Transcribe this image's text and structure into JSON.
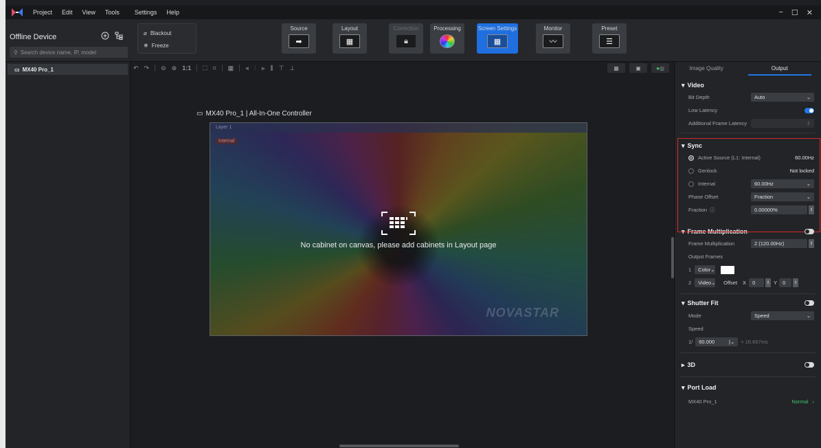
{
  "menu": [
    "Project",
    "Edit",
    "View",
    "Tools",
    "Settings",
    "Help"
  ],
  "window_controls": [
    "−",
    "☐",
    "✕"
  ],
  "device_panel": {
    "title": "Offline Device",
    "search_placeholder": "Search device name, IP, model",
    "devices": [
      "MX40 Pro_1"
    ]
  },
  "blackout_label": "Blackout",
  "freeze_label": "Freeze",
  "modules": [
    {
      "label": "Source",
      "icon": "arrow-right-icon"
    },
    {
      "label": "Layout",
      "icon": "cabinet-grid-icon"
    },
    {
      "label": "Correction",
      "icon": "lock-icon",
      "state": "disabled"
    },
    {
      "label": "Processing",
      "icon": "color-wheel-icon"
    },
    {
      "label": "Screen Settings",
      "icon": "screen-settings-icon",
      "state": "active"
    },
    {
      "label": "Monitor",
      "icon": "monitor-wave-icon"
    },
    {
      "label": "Preset",
      "icon": "preset-sliders-icon"
    }
  ],
  "canvas": {
    "controller_title": "MX40 Pro_1 | All-In-One Controller",
    "layer_label": "Layer 1",
    "source_tag": "Internal",
    "empty_message": "No cabinet on canvas, please add cabinets in Layout page",
    "watermark": "NOVASTAR",
    "zoom_label": "1:1"
  },
  "right_panel": {
    "tabs": [
      "Image Quality",
      "Output"
    ],
    "active_tab": "Output",
    "video": {
      "title": "Video",
      "bit_depth_label": "Bit Depth",
      "bit_depth_value": "Auto",
      "low_latency_label": "Low Latency",
      "low_latency_on": true,
      "additional_latency_label": "Additional Frame Latency"
    },
    "sync": {
      "title": "Sync",
      "active_source_label": "Active Source (L1: Internal)",
      "active_source_value": "60.00Hz",
      "genlock_label": "Genlock",
      "genlock_value": "Not locked",
      "internal_label": "Internal",
      "internal_value": "60.00Hz",
      "phase_offset_label": "Phase Offset",
      "phase_offset_value": "Fraction",
      "fraction_label": "Fraction",
      "fraction_value": "0.00000%"
    },
    "frame_mult": {
      "title": "Frame Multiplication",
      "enabled": false,
      "mult_label": "Frame Multiplication",
      "mult_value": "2 (120.00Hz)",
      "output_frames_label": "Output Frames",
      "frame1_index": "1",
      "frame1_type": "Color",
      "frame2_index": "2",
      "frame2_type": "Video",
      "offset_label": "Offset",
      "x_label": "X",
      "x_value": "0",
      "y_label": "Y",
      "y_value": "0",
      "color_swatch": "#ffffff"
    },
    "shutter_fit": {
      "title": "Shutter Fit",
      "enabled": false,
      "mode_label": "Mode",
      "mode_value": "Speed",
      "speed_label": "Speed",
      "speed_prefix": "1/",
      "speed_value": "60.000",
      "speed_result": "= 16.667ms"
    },
    "three_d": {
      "title": "3D",
      "enabled": false
    },
    "port_load": {
      "title": "Port Load",
      "device": "MX40 Pro_1",
      "status": "Normal"
    }
  },
  "colors": {
    "accent": "#1f78e6",
    "highlight_border": "#d32a2a",
    "status_ok": "#3ec46d"
  }
}
